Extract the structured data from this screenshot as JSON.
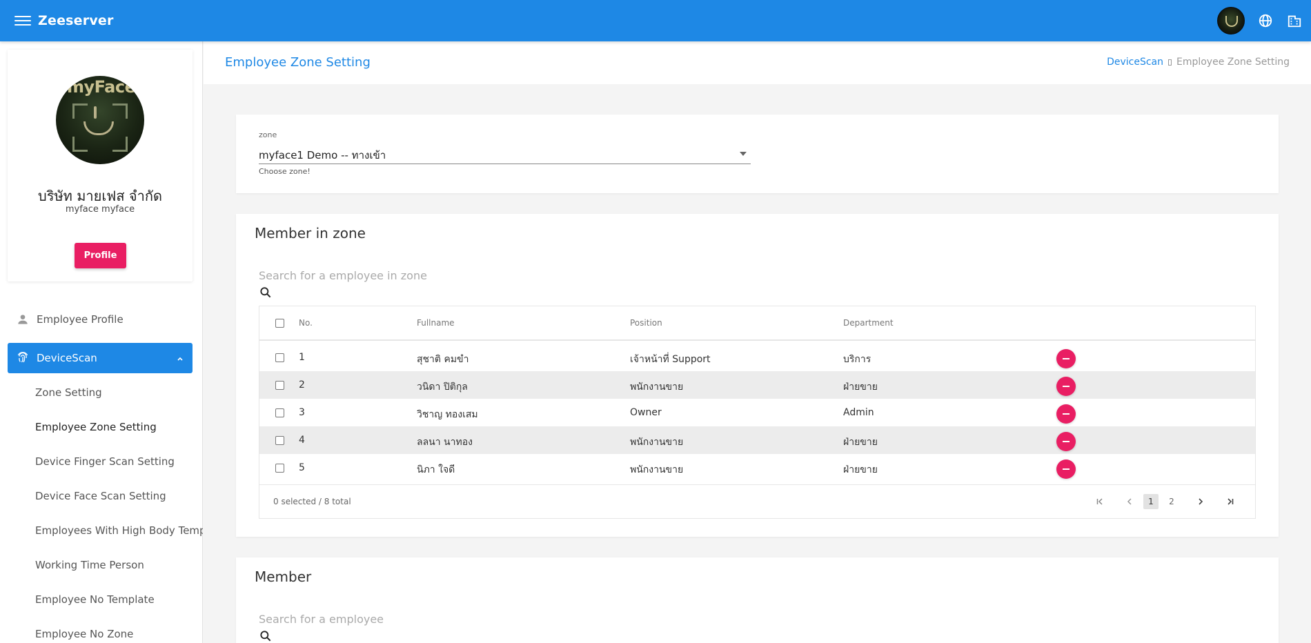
{
  "app": {
    "title": "Zeeserver"
  },
  "topbar": {
    "menu_icon": "menu-icon",
    "language_icon": "globe-icon",
    "org_icon": "building-icon"
  },
  "profile": {
    "avatar_text": "myFace",
    "company": "บริษัท มายเฟส จำกัด",
    "username": "myface myface",
    "button_label": "Profile"
  },
  "sidebar": {
    "employee_profile": "Employee Profile",
    "devicescan": "DeviceScan",
    "sub_items": [
      "Zone Setting",
      "Employee Zone Setting",
      "Device Finger Scan Setting",
      "Device Face Scan Setting",
      "Employees With High Body Temperature",
      "Working Time Person",
      "Employee No Template",
      "Employee No Zone"
    ]
  },
  "header": {
    "title": "Employee Zone Setting",
    "breadcrumb": [
      "DeviceScan",
      "Employee Zone Setting"
    ]
  },
  "zone": {
    "label": "zone",
    "value": "myface1 Demo -- ทางเข้า",
    "hint": "Choose zone!"
  },
  "member_in_zone": {
    "title": "Member in zone",
    "search_placeholder": "Search for a employee in zone",
    "columns": [
      "No.",
      "Fullname",
      "Position",
      "Department"
    ],
    "rows": [
      {
        "no": "1",
        "fullname": "สุชาติ คมขำ",
        "position": "เจ้าหน้าที่ Support",
        "department": "บริการ"
      },
      {
        "no": "2",
        "fullname": "วนิดา ปิติกุล",
        "position": "พนักงานขาย",
        "department": "ฝ่ายขาย"
      },
      {
        "no": "3",
        "fullname": "วิชาญ ทองเสม",
        "position": "Owner",
        "department": "Admin"
      },
      {
        "no": "4",
        "fullname": "ลลนา นาทอง",
        "position": "พนักงานขาย",
        "department": "ฝ่ายขาย"
      },
      {
        "no": "5",
        "fullname": "นิภา ใจดี",
        "position": "พนักงานขาย",
        "department": "ฝ่ายขาย"
      }
    ],
    "selection": "0 selected / 8 total",
    "pages": [
      "1",
      "2"
    ],
    "current_page": "1"
  },
  "member": {
    "title": "Member",
    "search_placeholder": "Search for a employee"
  },
  "colors": {
    "primary": "#1e88e5",
    "accent": "#e91e63",
    "row_alt": "#ececec"
  }
}
